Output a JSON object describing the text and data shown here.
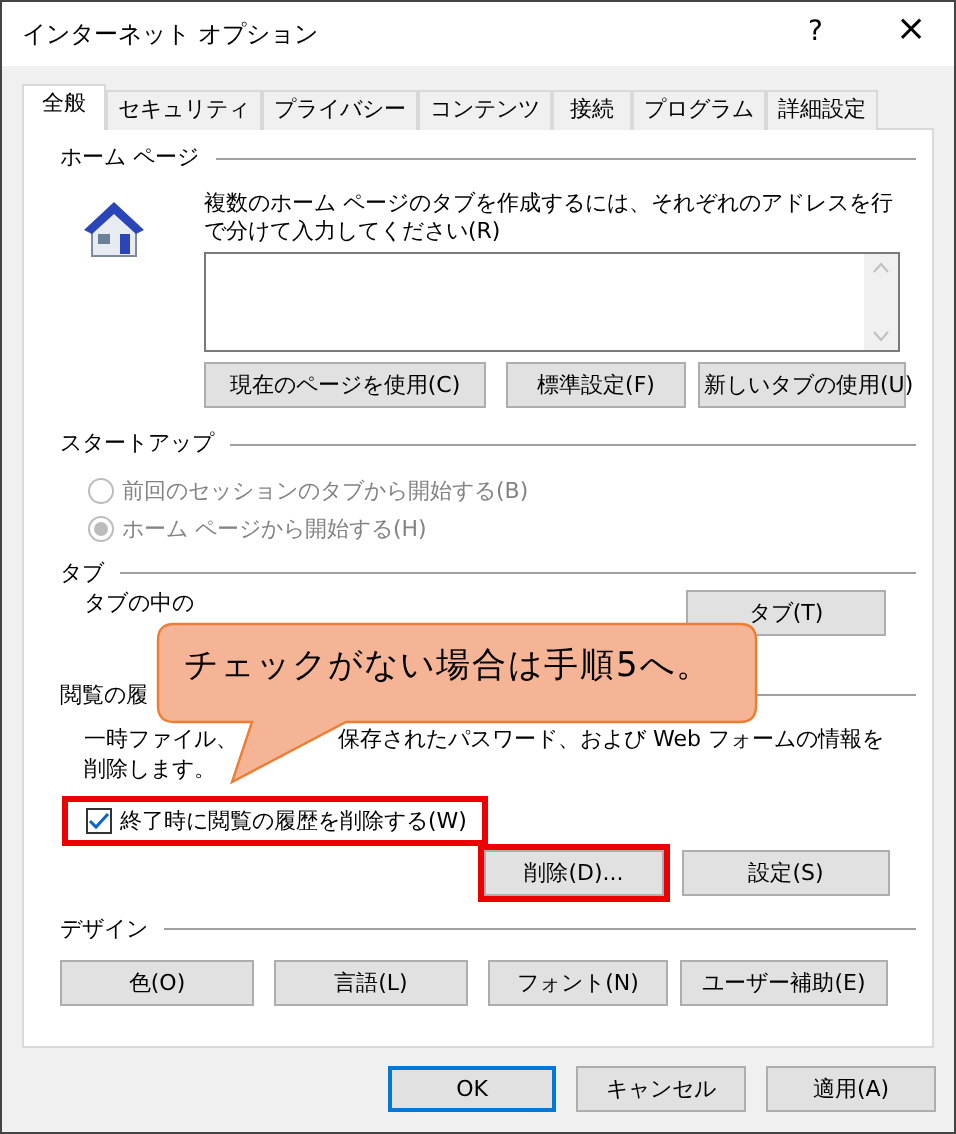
{
  "window": {
    "title": "インターネット オプション",
    "help": "?",
    "close": "×"
  },
  "tabs": [
    {
      "label": "全般",
      "selected": true
    },
    {
      "label": "セキュリティ",
      "selected": false
    },
    {
      "label": "プライバシー",
      "selected": false
    },
    {
      "label": "コンテンツ",
      "selected": false
    },
    {
      "label": "接続",
      "selected": false
    },
    {
      "label": "プログラム",
      "selected": false
    },
    {
      "label": "詳細設定",
      "selected": false
    }
  ],
  "home_page": {
    "heading": "ホーム ページ",
    "description": "複数のホーム ページのタブを作成するには、それぞれのアドレスを行で分けて入力してください(R)",
    "buttons": [
      "現在のページを使用(C)",
      "標準設定(F)",
      "新しいタブの使用(U)"
    ]
  },
  "startup": {
    "heading": "スタートアップ",
    "options": [
      {
        "label": "前回のセッションのタブから開始する(B)",
        "selected": false,
        "disabled": true
      },
      {
        "label": "ホーム ページから開始する(H)",
        "selected": true,
        "disabled": true
      }
    ]
  },
  "tab_settings": {
    "heading": "タブ",
    "description": "タブの中の",
    "button": "タブ(T)"
  },
  "history": {
    "heading": "閲覧の履",
    "description_parts": [
      "一時ファイル、",
      "保存されたパスワード、および Web フォームの情報を",
      "削除します。"
    ],
    "checkbox": {
      "label": "終了時に閲覧の履歴を削除する(W)",
      "checked": true,
      "highlighted": true
    },
    "buttons": [
      {
        "label": "削除(D)...",
        "highlighted": true
      },
      {
        "label": "設定(S)",
        "highlighted": false
      }
    ]
  },
  "design": {
    "heading": "デザイン",
    "buttons": [
      "色(O)",
      "言語(L)",
      "フォント(N)",
      "ユーザー補助(E)"
    ]
  },
  "footer_buttons": [
    {
      "label": "OK",
      "default": true
    },
    {
      "label": "キャンセル",
      "default": false
    },
    {
      "label": "適用(A)",
      "default": false
    }
  ],
  "callout": {
    "text": "チェックがない場合は手順5へ。"
  }
}
